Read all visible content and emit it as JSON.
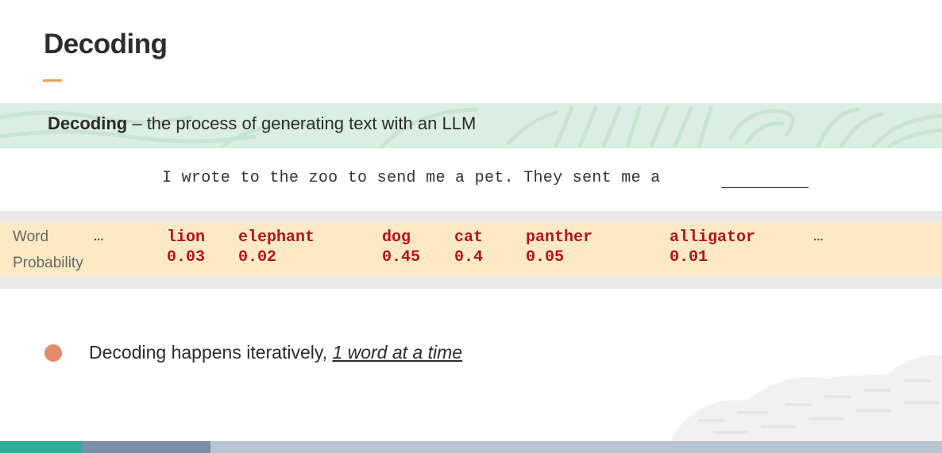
{
  "slide": {
    "title": "Decoding"
  },
  "definition": {
    "term": "Decoding",
    "rest": " – the process of generating text with an LLM"
  },
  "sentence": {
    "text": "I wrote to the zoo to send me a pet. They sent me a"
  },
  "table": {
    "word_label": "Word",
    "probability_label": "Probability",
    "ellipsis_left": "...",
    "ellipsis_right": "...",
    "candidates": [
      {
        "word": "lion",
        "prob": "0.03"
      },
      {
        "word": "elephant",
        "prob": "0.02"
      },
      {
        "word": "dog",
        "prob": "0.45"
      },
      {
        "word": "cat",
        "prob": "0.4"
      },
      {
        "word": "panther",
        "prob": "0.05"
      },
      {
        "word": "alligator",
        "prob": "0.01"
      }
    ]
  },
  "bullet": {
    "text": "Decoding happens iteratively, ",
    "emphasis": "1 word at a time"
  },
  "colors": {
    "accent_orange": "#e8a15a",
    "band_green": "#dbeee3",
    "band_yellow": "#fdeac4",
    "word_red": "#b5121b",
    "bullet_dot": "#e38b6d"
  }
}
